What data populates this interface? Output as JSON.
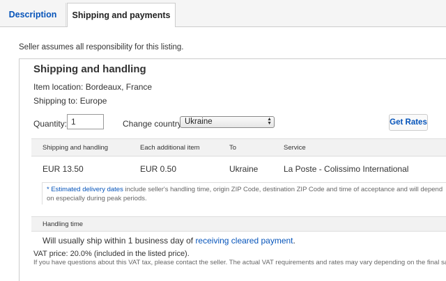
{
  "tabs": {
    "description": "Description",
    "shipping_payments": "Shipping and payments"
  },
  "disclaimer": "Seller assumes all responsibility for this listing.",
  "shipping": {
    "title": "Shipping and handling",
    "item_location": "Item location: Bordeaux, France",
    "shipping_to": "Shipping to: Europe",
    "quantity_label": "Quantity:",
    "quantity_value": "1",
    "change_country_label": "Change country:",
    "country_selected": "Ukraine",
    "get_rates_label": "Get Rates"
  },
  "table": {
    "headers": [
      "Shipping and handling",
      "Each additional item",
      "To",
      "Service"
    ],
    "row": [
      "EUR 13.50",
      "EUR 0.50",
      "Ukraine",
      "La Poste - Colissimo International"
    ]
  },
  "note": {
    "prefix": "* ",
    "link": "Estimated delivery dates",
    "text": " include seller's handling time, origin ZIP Code, destination ZIP Code and time of acceptance and will depend on especially during peak periods."
  },
  "handling": {
    "header": "Handling time",
    "text": "Will usually ship within 1 business day of ",
    "link": "receiving cleared payment",
    "suffix": "."
  },
  "vat": {
    "price": "VAT price: 20.0% (included in the listed price).",
    "note": "If you have questions about this VAT tax, please contact the seller. The actual VAT requirements and rates may vary depending on the final sale."
  },
  "icons": {
    "select_arrows": "up-down-arrows-icon"
  },
  "colors": {
    "link": "#0654ba",
    "header_bg": "#f2f2f2"
  }
}
